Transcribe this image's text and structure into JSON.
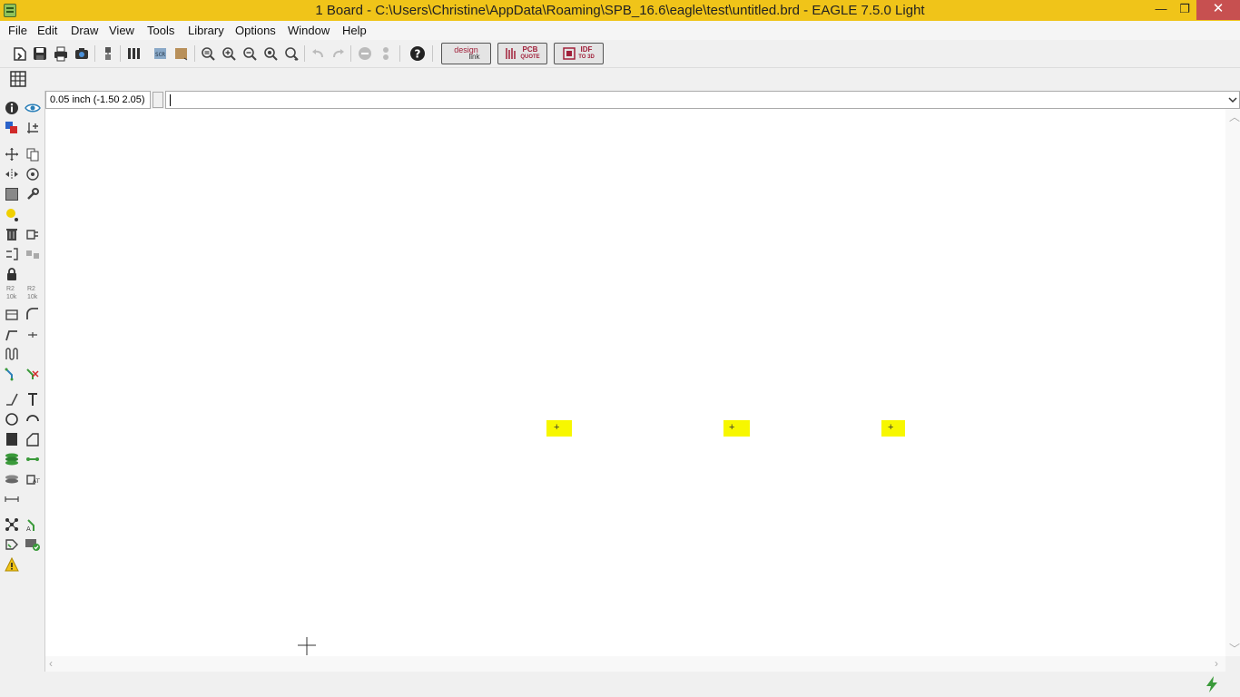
{
  "window": {
    "title": "1 Board - C:\\Users\\Christine\\AppData\\Roaming\\SPB_16.6\\eagle\\test\\untitled.brd - EAGLE 7.5.0 Light",
    "controls": {
      "minimize": "—",
      "maximize": "❐",
      "close": "✕"
    }
  },
  "menu": {
    "items": [
      "File",
      "Edit",
      "Draw",
      "View",
      "Tools",
      "Library",
      "Options",
      "Window",
      "Help"
    ]
  },
  "toolbar": {
    "buttons": [
      "open-icon",
      "save-icon",
      "print-icon",
      "cam-processor-icon",
      "schematic-board-switch-icon",
      "use-library-icon",
      "script-icon",
      "run-ulp-icon",
      "zoom-fit-icon",
      "zoom-in-icon",
      "zoom-out-icon",
      "redraw-icon",
      "zoom-select-icon",
      "undo-icon",
      "redo-icon",
      "stop-icon",
      "go-icon",
      "help-icon"
    ],
    "ext_buttons": [
      {
        "name": "design-link",
        "line1": "design",
        "line2": "link"
      },
      {
        "name": "pcb-quote",
        "line1": "PCB",
        "line2": "QUOTE"
      },
      {
        "name": "idf-to-3d",
        "line1": "IDF",
        "line2": "TO 3D"
      }
    ],
    "grid_button": "grid-icon"
  },
  "command": {
    "grid_status": "0.05 inch (-1.50 2.05)",
    "input_value": "",
    "dropdown_icon": "chevron-down-icon"
  },
  "tools": {
    "labels": {
      "r2_a": "R2",
      "val_a": "10k",
      "r2_b": "R2",
      "val_b": "10k"
    }
  },
  "canvas": {
    "background": "#ffffff",
    "pad_color": "#f7f700",
    "pads": [
      {
        "marker": "+"
      },
      {
        "marker": "+"
      },
      {
        "marker": "+"
      }
    ]
  },
  "status": {
    "text": "",
    "icon": "lightning-icon"
  },
  "colors": {
    "titlebar": "#f0c419",
    "close_button": "#c75050",
    "accent_green": "#3a9a3a"
  }
}
